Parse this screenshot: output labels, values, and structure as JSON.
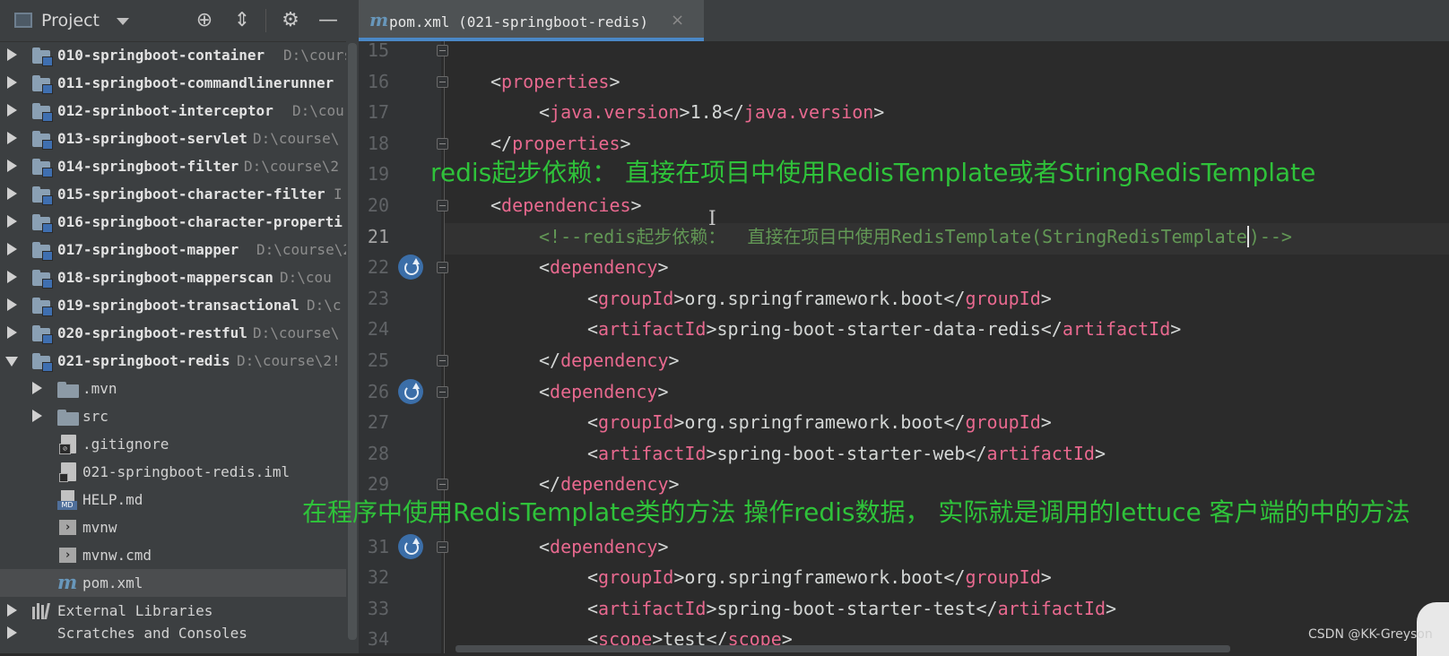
{
  "project_panel": {
    "title": "Project",
    "header_buttons": [
      "crosshair-icon",
      "collapse-all-icon",
      "gear-icon",
      "minimize-icon"
    ],
    "modules": [
      {
        "name": "010-springboot-container",
        "path": "D:\\cours"
      },
      {
        "name": "011-springboot-commandlinerunner",
        "path": ""
      },
      {
        "name": "012-sprinboot-interceptor",
        "path": "D:\\cou"
      },
      {
        "name": "013-springboot-servlet",
        "path": "D:\\course\\"
      },
      {
        "name": "014-springboot-filter",
        "path": "D:\\course\\2"
      },
      {
        "name": "015-springboot-character-filter",
        "path": "I"
      },
      {
        "name": "016-springboot-character-properti",
        "path": ""
      },
      {
        "name": "017-springboot-mapper",
        "path": "D:\\course\\2"
      },
      {
        "name": "018-springboot-mapperscan",
        "path": "D:\\cou"
      },
      {
        "name": "019-springboot-transactional",
        "path": "D:\\c"
      },
      {
        "name": "020-springboot-restful",
        "path": "D:\\course\\"
      },
      {
        "name": "021-springboot-redis",
        "path": "D:\\course\\2!"
      }
    ],
    "children": [
      {
        "name": ".mvn",
        "kind": "folder"
      },
      {
        "name": "src",
        "kind": "folder"
      },
      {
        "name": ".gitignore",
        "kind": "ignore-file"
      },
      {
        "name": "021-springboot-redis.iml",
        "kind": "iml-file"
      },
      {
        "name": "HELP.md",
        "kind": "markdown-file",
        "badge": "MD"
      },
      {
        "name": "mvnw",
        "kind": "shell-file"
      },
      {
        "name": "mvnw.cmd",
        "kind": "cmd-file"
      },
      {
        "name": "pom.xml",
        "kind": "maven-file",
        "selected": true
      }
    ],
    "external_libraries": "External Libraries",
    "scratches": "Scratches and Consoles"
  },
  "editor": {
    "tab": {
      "label": "pom.xml (021-springboot-redis)",
      "close": "×",
      "icon": "m"
    },
    "current_line": "21",
    "lines": [
      {
        "n": "15"
      },
      {
        "n": "16",
        "open": "<",
        "tag": "properties",
        "close": ">"
      },
      {
        "n": "17",
        "open": "<",
        "tag": "java.version",
        "mid": ">1.8</",
        "tag2": "java.version",
        "close": ">"
      },
      {
        "n": "18",
        "open": "</",
        "tag": "properties",
        "close": ">"
      },
      {
        "n": "19"
      },
      {
        "n": "20",
        "open": "<",
        "tag": "dependencies",
        "close": ">"
      },
      {
        "n": "21",
        "comment_a": "<!--redis起步依赖：  直接在项目中使用RedisTemplate(StringRedisTemplate",
        "comment_b": ")-->"
      },
      {
        "n": "22",
        "open": "<",
        "tag": "dependency",
        "close": ">"
      },
      {
        "n": "23",
        "open": "<",
        "tag": "groupId",
        "mid": ">org.springframework.boot</",
        "tag2": "groupId",
        "close": ">"
      },
      {
        "n": "24",
        "open": "<",
        "tag": "artifactId",
        "mid": ">spring-boot-starter-data-redis</",
        "tag2": "artifactId",
        "close": ">"
      },
      {
        "n": "25",
        "open": "</",
        "tag": "dependency",
        "close": ">"
      },
      {
        "n": "26",
        "open": "<",
        "tag": "dependency",
        "close": ">"
      },
      {
        "n": "27",
        "open": "<",
        "tag": "groupId",
        "mid": ">org.springframework.boot</",
        "tag2": "groupId",
        "close": ">"
      },
      {
        "n": "28",
        "open": "<",
        "tag": "artifactId",
        "mid": ">spring-boot-starter-web</",
        "tag2": "artifactId",
        "close": ">"
      },
      {
        "n": "29",
        "open": "</",
        "tag": "dependency",
        "close": ">"
      },
      {
        "n": "31",
        "open": "<",
        "tag": "dependency",
        "close": ">"
      },
      {
        "n": "32",
        "open": "<",
        "tag": "groupId",
        "mid": ">org.springframework.boot</",
        "tag2": "groupId",
        "close": ">"
      },
      {
        "n": "33",
        "open": "<",
        "tag": "artifactId",
        "mid": ">spring-boot-starter-test</",
        "tag2": "artifactId",
        "close": ">"
      },
      {
        "n": "34",
        "open": "<",
        "tag": "scope",
        "mid": ">test</",
        "tag2": "scope",
        "close": ">"
      }
    ]
  },
  "annotations": {
    "redis_note": "redis起步依赖：  直接在项目中使用RedisTemplate或者StringRedisTemplate",
    "template_note": "在程序中使用RedisTemplate类的方法 操作redis数据，  实际就是调用的lettuce 客户端的中的方法",
    "color": "#2fc23a"
  },
  "watermark": "CSDN @KK-Greyson"
}
